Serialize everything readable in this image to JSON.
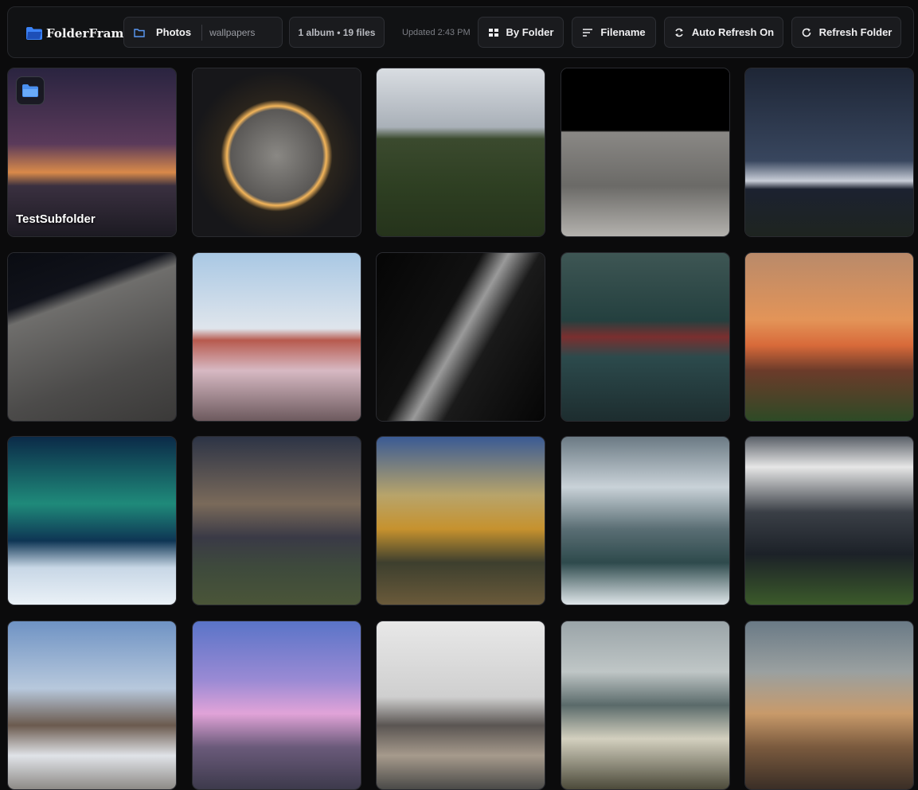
{
  "app": {
    "name": "FolderFrame"
  },
  "breadcrumb": {
    "root": "Photos",
    "current": "wallpapers"
  },
  "summary": {
    "count": "1 album • 19 files",
    "updated": "Updated 2:43 PM"
  },
  "toolbar": {
    "group_label": "By Folder",
    "sort_label": "Filename",
    "auto_refresh_label": "Auto Refresh On",
    "refresh_label": "Refresh Folder"
  },
  "colors": {
    "accent": "#3b82f6",
    "background": "#0b0b0c",
    "panel": "#111214"
  },
  "tiles": [
    {
      "kind": "folder",
      "label": "TestSubfolder",
      "bg": "linear-gradient(180deg,#2a2440 0%,#5a3a5a 45%,#d98a4a 62%,#3a3040 70%,#1c1a22 100%)"
    },
    {
      "kind": "photo",
      "name": "moon-eclipse",
      "bg": "radial-gradient(circle at 50% 52%,#8a8884 0%,#5a5856 38%,#f3b55a 41%,#2a241c 46%,#17171a 70%)"
    },
    {
      "kind": "photo",
      "name": "forest-valley",
      "bg": "linear-gradient(180deg,#d9dde2 0%,#a9b0b8 35%,#3b4a2e 42%,#2e3f22 70%,#25331b 100%)"
    },
    {
      "kind": "photo",
      "name": "lunar-rover",
      "bg": "linear-gradient(180deg,#000 0%,#000 37%,#8a8885 38%,#6b6a67 70%,#b4b2ae 100%)"
    },
    {
      "kind": "photo",
      "name": "mount-fuji-night",
      "bg": "linear-gradient(180deg,#1e2636 0%,#38465e 55%,#c9ced8 67%,#1c2230 72%,#1e2420 100%)"
    },
    {
      "kind": "photo",
      "name": "moon-surface",
      "bg": "linear-gradient(160deg,#0a0c12 0%,#10121a 25%,#6f6e6c 32%,#4c4b4a 70%,#3a3938 100%)"
    },
    {
      "kind": "photo",
      "name": "pagoda-fuji",
      "bg": "linear-gradient(180deg,#a9c8e4 0%,#dfe5ec 45%,#b75a4e 52%,#d7b9c3 70%,#6d5a5e 100%)"
    },
    {
      "kind": "photo",
      "name": "night-house",
      "bg": "linear-gradient(120deg,#050505 0%,#111 40%,#9a9a9a 50%,#1a1a1a 62%,#050505 100%)"
    },
    {
      "kind": "photo",
      "name": "cyber-highway",
      "bg": "linear-gradient(180deg,#3e5654 0%,#24403f 40%,#7a2f2f 50%,#2c4a4c 62%,#1d2d2f 100%)"
    },
    {
      "kind": "photo",
      "name": "sunset-chimney",
      "bg": "linear-gradient(180deg,#b98a6a 0%,#e39458 40%,#d86a3a 55%,#6c3b2a 70%,#2e4a26 100%)"
    },
    {
      "kind": "photo",
      "name": "aurora-tree",
      "bg": "linear-gradient(180deg,#0b2a48 0%,#1f8a7a 40%,#0e3554 62%,#c8d7e6 78%,#eaf1f7 100%)"
    },
    {
      "kind": "photo",
      "name": "milky-way",
      "bg": "linear-gradient(180deg,#2d3446 0%,#7a6a5a 40%,#3a3a46 60%,#3e4a3c 78%,#4a5538 100%)"
    },
    {
      "kind": "photo",
      "name": "rocket-launch",
      "bg": "linear-gradient(180deg,#3a5a94 0%,#b8a46a 35%,#c6922e 55%,#3d3f2e 75%,#6a5a3a 100%)"
    },
    {
      "kind": "photo",
      "name": "snowy-river",
      "bg": "linear-gradient(180deg,#6b7a84 0%,#c9d2d8 30%,#5a6e74 55%,#2e4a4c 75%,#dfe6ea 100%)"
    },
    {
      "kind": "photo",
      "name": "stadium-game",
      "bg": "linear-gradient(180deg,#5a6068 0%,#e6e6e6 18%,#3a3f46 45%,#1c2128 70%,#3b5a2a 100%)"
    },
    {
      "kind": "photo",
      "name": "city-chimney",
      "bg": "linear-gradient(180deg,#6f93c4 0%,#b7c8dc 40%,#6b5a4e 62%,#e0e3e8 80%,#8d8a86 100%)"
    },
    {
      "kind": "photo",
      "name": "purple-mountains",
      "bg": "linear-gradient(180deg,#5a74c8 0%,#9a8ad4 35%,#e1a3d8 55%,#6a5a7a 75%,#3d3a4c 100%)"
    },
    {
      "kind": "photo",
      "name": "city-skyline",
      "bg": "linear-gradient(180deg,#e8e8e8 0%,#cfcfcf 45%,#5a5552 62%,#a69a8c 80%,#4a4a48 100%)"
    },
    {
      "kind": "photo",
      "name": "beach-landing",
      "bg": "linear-gradient(180deg,#9aa4a8 0%,#bfc6c6 30%,#5a6a6a 50%,#d3d0bf 70%,#4c4a3a 100%)"
    },
    {
      "kind": "photo",
      "name": "fallout-sign",
      "bg": "linear-gradient(180deg,#6a7a86 0%,#9aa0a0 30%,#c89a6a 55%,#7a5a3e 75%,#3a2e26 100%)"
    }
  ]
}
